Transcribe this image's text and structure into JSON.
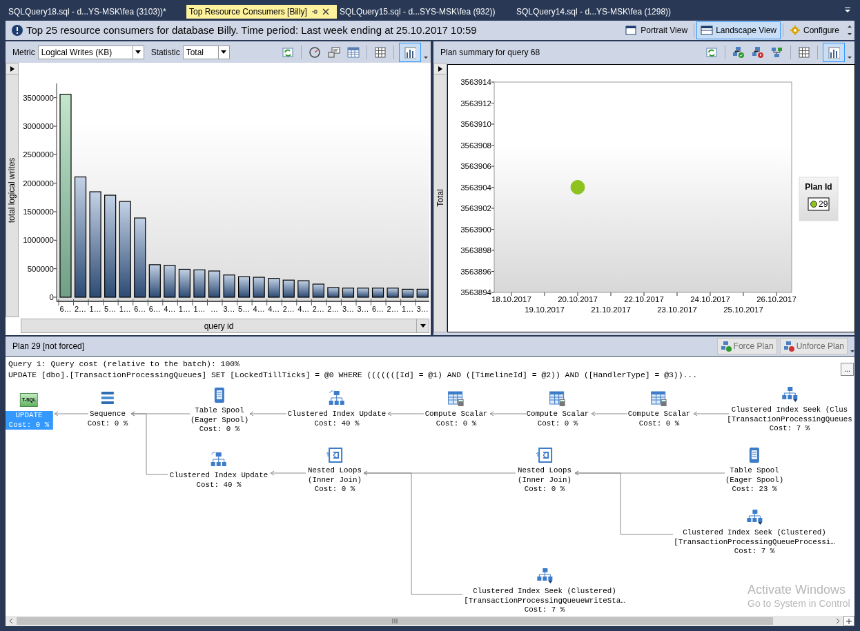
{
  "document_tabs": [
    {
      "label": "SQLQuery18.sql - d...YS-MSK\\fea (3103))*",
      "selected": false
    },
    {
      "label": "Top Resource Consumers [Billy]",
      "selected": true
    },
    {
      "label": "SQLQuery15.sql - d...SYS-MSK\\fea (932))",
      "selected": false
    },
    {
      "label": "SQLQuery14.sql - d...YS-MSK\\fea (1298))",
      "selected": false
    }
  ],
  "header": {
    "title": "Top 25 resource consumers for database Billy. Time period: Last week ending at 25.10.2017 10:59",
    "views": [
      {
        "label": "Portrait View",
        "kind": "portrait",
        "selected": false
      },
      {
        "label": "Landscape View",
        "kind": "landscape",
        "selected": true
      }
    ],
    "configure": "Configure"
  },
  "left_pane": {
    "metric_label": "Metric",
    "metric_value": "Logical Writes (KB)",
    "statistic_label": "Statistic",
    "statistic_value": "Total",
    "toolbar_buttons": [
      {
        "kind": "refresh",
        "selected": false
      },
      {
        "kind": "gauge",
        "selected": false
      },
      {
        "kind": "tooltip",
        "selected": false
      },
      {
        "kind": "detail-grid",
        "selected": false
      },
      {
        "kind": "grid",
        "selected": false
      },
      {
        "kind": "chart",
        "selected": true
      }
    ],
    "bars": [
      {
        "selected": true
      },
      {
        "selected": false
      },
      {
        "selected": false
      },
      {
        "selected": false
      },
      {
        "selected": false
      },
      {
        "selected": false
      },
      {
        "selected": false
      },
      {
        "selected": false
      },
      {
        "selected": false
      },
      {
        "selected": false
      },
      {
        "selected": false
      },
      {
        "selected": false
      },
      {
        "selected": false
      },
      {
        "selected": false
      },
      {
        "selected": false
      },
      {
        "selected": false
      },
      {
        "selected": false
      },
      {
        "selected": false
      },
      {
        "selected": false
      },
      {
        "selected": false
      },
      {
        "selected": false
      },
      {
        "selected": false
      },
      {
        "selected": false
      },
      {
        "selected": false
      },
      {
        "selected": false
      }
    ],
    "chart_data": {
      "type": "bar",
      "xlabel": "query id",
      "ylabel": "total logical writes",
      "categories": [
        "6…",
        "2…",
        "1…",
        "5…",
        "1…",
        "6…",
        "6…",
        "4…",
        "1…",
        "1…",
        "…",
        "3…",
        "5…",
        "4…",
        "4…",
        "2…",
        "4…",
        "2…",
        "2…",
        "3…",
        "3…",
        "6…",
        "2…",
        "1…",
        "3…"
      ],
      "values": [
        3560000,
        2110000,
        1850000,
        1790000,
        1680000,
        1390000,
        570000,
        560000,
        490000,
        480000,
        460000,
        390000,
        360000,
        350000,
        330000,
        300000,
        290000,
        230000,
        170000,
        160000,
        160000,
        160000,
        160000,
        140000,
        140000
      ],
      "ylim": [
        0,
        3750000
      ],
      "yticks": [
        0,
        500000,
        1000000,
        1500000,
        2000000,
        2500000,
        3000000,
        3500000
      ]
    }
  },
  "right_pane": {
    "title": "Plan summary for query 68",
    "toolbar_buttons": [
      {
        "kind": "refresh",
        "selected": false
      },
      {
        "kind": "plan-approve",
        "selected": false
      },
      {
        "kind": "plan-force",
        "selected": false
      },
      {
        "kind": "compare",
        "selected": false
      },
      {
        "kind": "grid",
        "selected": false
      },
      {
        "kind": "chart",
        "selected": true
      }
    ],
    "legend_title": "Plan Id",
    "chart_data": {
      "type": "scatter",
      "ylabel": "Total",
      "categories": [
        "18.10.2017",
        "19.10.2017",
        "20.10.2017",
        "21.10.2017",
        "22.10.2017",
        "23.10.2017",
        "24.10.2017",
        "25.10.2017",
        "26.10.2017"
      ],
      "series": [
        {
          "name": "29",
          "color": "#8dc21f",
          "values": [
            null,
            null,
            3563904,
            null,
            null,
            null,
            null,
            null,
            null
          ]
        }
      ],
      "ylim": [
        3563894,
        3563914
      ],
      "yticks": [
        3563894,
        3563896,
        3563898,
        3563900,
        3563902,
        3563904,
        3563906,
        3563908,
        3563910,
        3563912,
        3563914
      ]
    }
  },
  "plan": {
    "title": "Plan 29 [not forced]",
    "buttons": [
      {
        "label": "Force Plan",
        "kind": "force",
        "disabled": true
      },
      {
        "label": "Unforce Plan",
        "kind": "unforce",
        "disabled": true
      }
    ],
    "query_lines": [
      "Query 1: Query cost (relative to the batch): 100%",
      "UPDATE [dbo].[TransactionProcessingQueues] SET [LockedTillTicks] = @0 WHERE (((((([Id] = @1) AND ([TimelineId] = @2)) AND ([HandlerType] = @3))..."
    ],
    "more_button": "...",
    "nodes": [
      {
        "kind": "tsql",
        "icon_text": "T-SQL",
        "label": [
          "UPDATE"
        ],
        "cost": "Cost: 0 %",
        "selected": true,
        "children": [
          {
            "kind": "sequence",
            "label": [
              "Sequence"
            ],
            "cost": "Cost: 0 %",
            "selected": false,
            "children": [
              {
                "kind": "spool",
                "label": [
                  "Table Spool",
                  "(Eager Spool)"
                ],
                "cost": "Cost: 0 %",
                "selected": false,
                "children": [
                  {
                    "kind": "index-update",
                    "label": [
                      "Clustered Index Update"
                    ],
                    "cost": "Cost: 40 %",
                    "selected": false,
                    "children": [
                      {
                        "kind": "compute",
                        "label": [
                          "Compute Scalar"
                        ],
                        "cost": "Cost: 0 %",
                        "selected": false,
                        "children": [
                          {
                            "kind": "compute",
                            "label": [
                              "Compute Scalar"
                            ],
                            "cost": "Cost: 0 %",
                            "selected": false,
                            "children": [
                              {
                                "kind": "compute",
                                "label": [
                                  "Compute Scalar"
                                ],
                                "cost": "Cost: 0 %",
                                "selected": false,
                                "children": [
                                  {
                                    "kind": "index-seek",
                                    "label": [
                                      "Clustered Index Seek (Clus",
                                      "[TransactionProcessingQueues"
                                    ],
                                    "cost": "Cost: 7 %",
                                    "selected": false
                                  }
                                ]
                              }
                            ]
                          }
                        ]
                      }
                    ]
                  }
                ]
              },
              {
                "kind": "index-update",
                "label": [
                  "Clustered Index Update"
                ],
                "cost": "Cost: 40 %",
                "selected": false,
                "children": [
                  {
                    "kind": "nested-loops",
                    "label": [
                      "Nested Loops",
                      "(Inner Join)"
                    ],
                    "cost": "Cost: 0 %",
                    "selected": false,
                    "children": [
                      {
                        "kind": "nested-loops",
                        "label": [
                          "Nested Loops",
                          "(Inner Join)"
                        ],
                        "cost": "Cost: 0 %",
                        "selected": false,
                        "children": [
                          {
                            "kind": "spool",
                            "label": [
                              "Table Spool",
                              "(Eager Spool)"
                            ],
                            "cost": "Cost: 23 %",
                            "selected": false
                          },
                          {
                            "kind": "index-seek",
                            "label": [
                              "Clustered Index Seek (Clustered)",
                              "[TransactionProcessingQueueProcessi…"
                            ],
                            "cost": "Cost: 7 %",
                            "selected": false
                          }
                        ]
                      },
                      {
                        "kind": "index-seek",
                        "label": [
                          "Clustered Index Seek (Clustered)",
                          "[TransactionProcessingQueueWriteSta…"
                        ],
                        "cost": "Cost: 7 %",
                        "selected": false
                      }
                    ]
                  }
                ]
              }
            ]
          }
        ]
      }
    ]
  },
  "os_notice": {
    "title": "Activate Windows",
    "subtitle": "Go to System in Control"
  }
}
